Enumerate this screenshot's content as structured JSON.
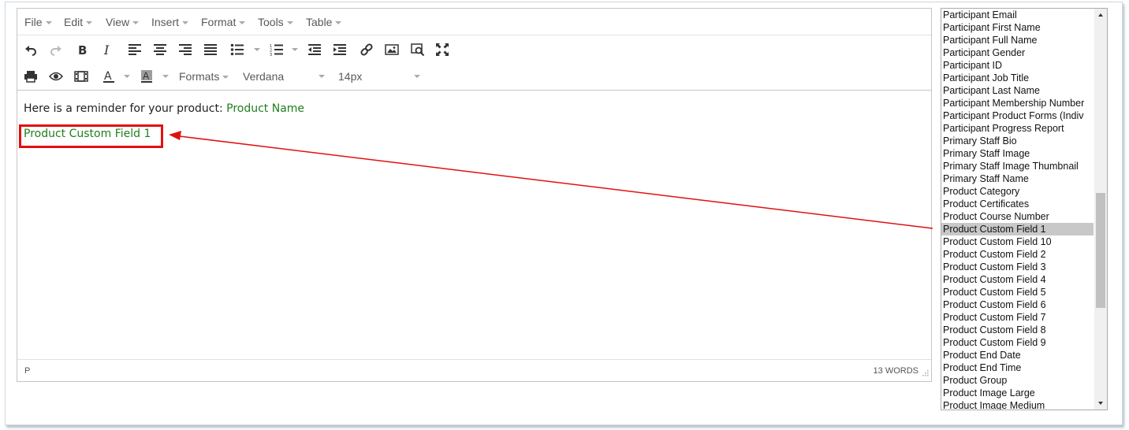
{
  "menubar": {
    "items": [
      {
        "label": "File"
      },
      {
        "label": "Edit"
      },
      {
        "label": "View"
      },
      {
        "label": "Insert"
      },
      {
        "label": "Format"
      },
      {
        "label": "Tools"
      },
      {
        "label": "Table"
      }
    ]
  },
  "toolbar1": {
    "icons": [
      "undo-icon",
      "redo-icon",
      "bold-icon",
      "italic-icon",
      "align-left-icon",
      "align-center-icon",
      "align-right-icon",
      "align-justify-icon",
      "bullet-list-icon",
      "numbered-list-icon",
      "outdent-icon",
      "indent-icon",
      "link-icon",
      "image-icon",
      "preview-search-icon",
      "fullscreen-icon"
    ]
  },
  "toolbar2": {
    "icons": [
      "print-icon",
      "eye-icon",
      "media-icon",
      "text-color-icon",
      "background-color-icon"
    ],
    "formats_label": "Formats",
    "font_family": "Verdana",
    "font_size": "14px"
  },
  "content": {
    "line1_prefix": "Here is a reminder for your product: ",
    "line1_merge": "Product Name",
    "line2_merge": "Product Custom Field 1"
  },
  "statusbar": {
    "path": "P",
    "wordcount": "13 WORDS"
  },
  "field_list": {
    "selected": "Product Custom Field 1",
    "items": [
      "Participant Email",
      "Participant First Name",
      "Participant Full Name",
      "Participant Gender",
      "Participant ID",
      "Participant Job Title",
      "Participant Last Name",
      "Participant Membership Number",
      "Participant Product Forms (Indiv",
      "Participant Progress Report",
      "Primary Staff Bio",
      "Primary Staff Image",
      "Primary Staff Image Thumbnail",
      "Primary Staff Name",
      "Product Category",
      "Product Certificates",
      "Product Course Number",
      "Product Custom Field 1",
      "Product Custom Field 10",
      "Product Custom Field 2",
      "Product Custom Field 3",
      "Product Custom Field 4",
      "Product Custom Field 5",
      "Product Custom Field 6",
      "Product Custom Field 7",
      "Product Custom Field 8",
      "Product Custom Field 9",
      "Product End Date",
      "Product End Time",
      "Product Group",
      "Product Image Large",
      "Product Image Medium"
    ]
  },
  "colors": {
    "merge_field": "#1e7f1e",
    "annotation": "#e21010",
    "selection": "#c8c8c8"
  }
}
